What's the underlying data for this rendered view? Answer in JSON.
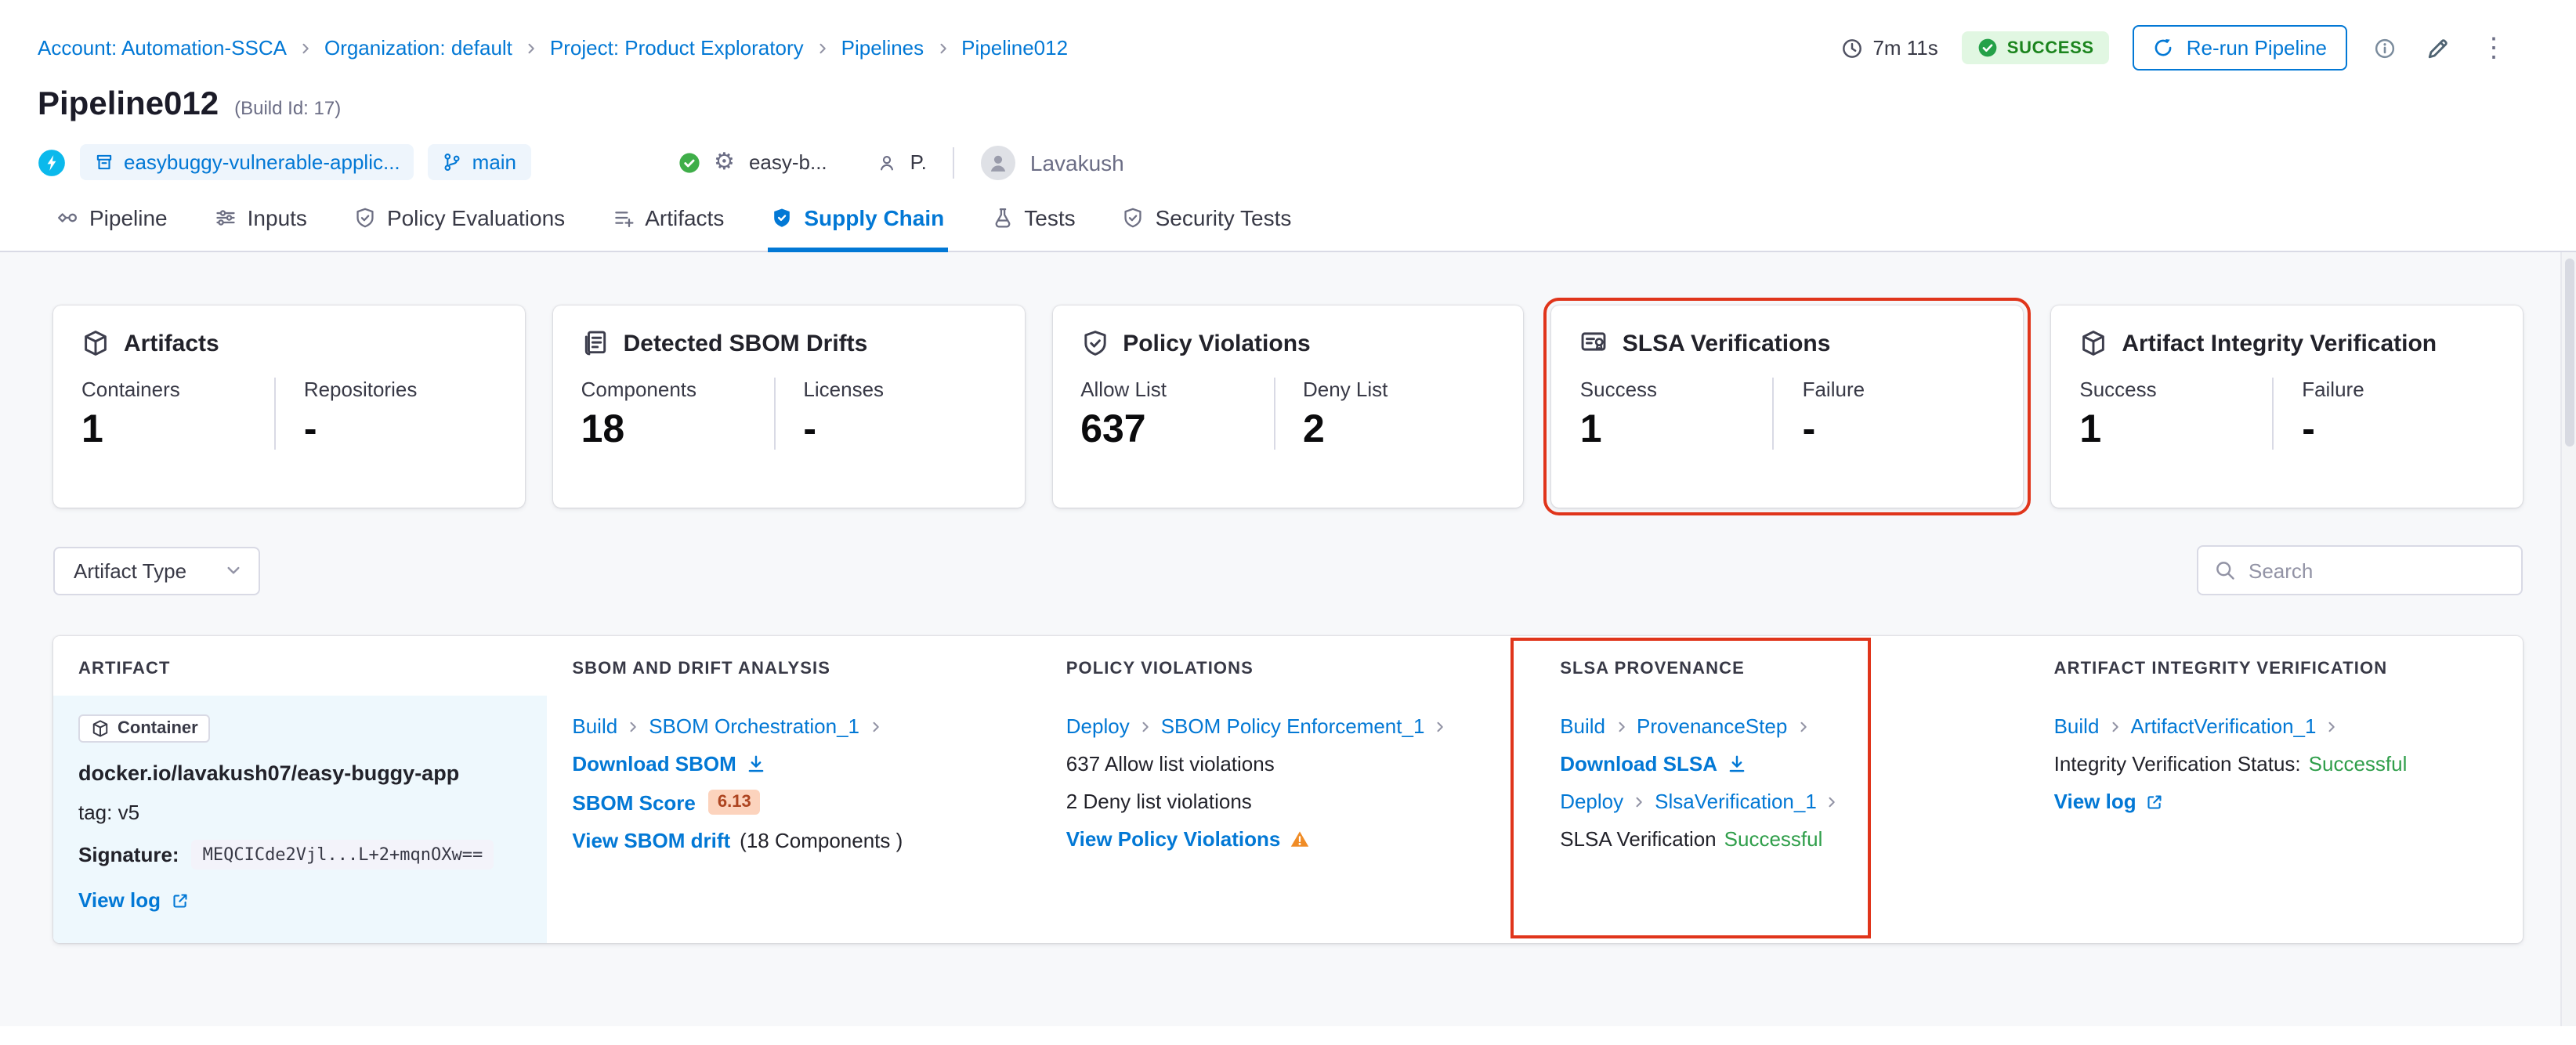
{
  "colors": {
    "accent_blue": "#0278d5",
    "success_badge_green": "#1b841d",
    "status_text_green": "#2f9e4a",
    "highlight_red": "#e0351b",
    "score_badge_bg": "#fcd3bd",
    "score_badge_text": "#ad4420",
    "warning_orange": "#f08c26"
  },
  "icons": {
    "gear": "⚙",
    "kebab": "⋮"
  },
  "breadcrumb": {
    "items": [
      "Account: Automation-SSCA",
      "Organization: default",
      "Project: Product Exploratory",
      "Pipelines",
      "Pipeline012"
    ]
  },
  "topbar": {
    "duration": "7m 11s",
    "status": "SUCCESS",
    "rerun_label": "Re-run Pipeline"
  },
  "header": {
    "title": "Pipeline012",
    "build_id": "(Build Id: 17)",
    "repo": "easybuggy-vulnerable-applic...",
    "branch": "main",
    "trigger": "easy-b...",
    "trigger_user_short": "P.",
    "user": "Lavakush"
  },
  "tabs": [
    "Pipeline",
    "Inputs",
    "Policy Evaluations",
    "Artifacts",
    "Supply Chain",
    "Tests",
    "Security Tests"
  ],
  "cards": [
    {
      "title": "Artifacts",
      "label1": "Containers",
      "value1": "1",
      "label2": "Repositories",
      "value2": "-"
    },
    {
      "title": "Detected SBOM Drifts",
      "label1": "Components",
      "value1": "18",
      "label2": "Licenses",
      "value2": "-"
    },
    {
      "title": "Policy Violations",
      "label1": "Allow List",
      "value1": "637",
      "label2": "Deny List",
      "value2": "2"
    },
    {
      "title": "SLSA Verifications",
      "label1": "Success",
      "value1": "1",
      "label2": "Failure",
      "value2": "-"
    },
    {
      "title": "Artifact Integrity Verification",
      "label1": "Success",
      "value1": "1",
      "label2": "Failure",
      "value2": "-"
    }
  ],
  "filters": {
    "artifact_type_label": "Artifact Type",
    "search_placeholder": "Search"
  },
  "table": {
    "headers": [
      "ARTIFACT",
      "SBOM AND DRIFT ANALYSIS",
      "POLICY VIOLATIONS",
      "SLSA PROVENANCE",
      "ARTIFACT INTEGRITY VERIFICATION"
    ],
    "row": {
      "artifact": {
        "type_badge": "Container",
        "image": "docker.io/lavakush07/easy-buggy-app",
        "tag": "tag: v5",
        "signature_label": "Signature:",
        "signature_value": "MEQCICde2Vjl...L+2+mqnOXw==",
        "view_log": "View log"
      },
      "sbom": {
        "stage": "Build",
        "step": "SBOM Orchestration_1",
        "download": "Download SBOM",
        "score_label": "SBOM Score",
        "score_value": "6.13",
        "drift_link": "View SBOM drift",
        "drift_suffix": "(18 Components )"
      },
      "policy": {
        "stage": "Deploy",
        "step": "SBOM Policy Enforcement_1",
        "allow": "637 Allow list violations",
        "deny": "2 Deny list violations",
        "view": "View Policy Violations"
      },
      "slsa": {
        "stage1": "Build",
        "step1": "ProvenanceStep",
        "download": "Download SLSA",
        "stage2": "Deploy",
        "step2": "SlsaVerification_1",
        "status_prefix": "SLSA Verification",
        "status_value": "Successful"
      },
      "integrity": {
        "stage": "Build",
        "step": "ArtifactVerification_1",
        "status_prefix": "Integrity Verification Status:",
        "status_value": "Successful",
        "view_log": "View log"
      }
    }
  }
}
